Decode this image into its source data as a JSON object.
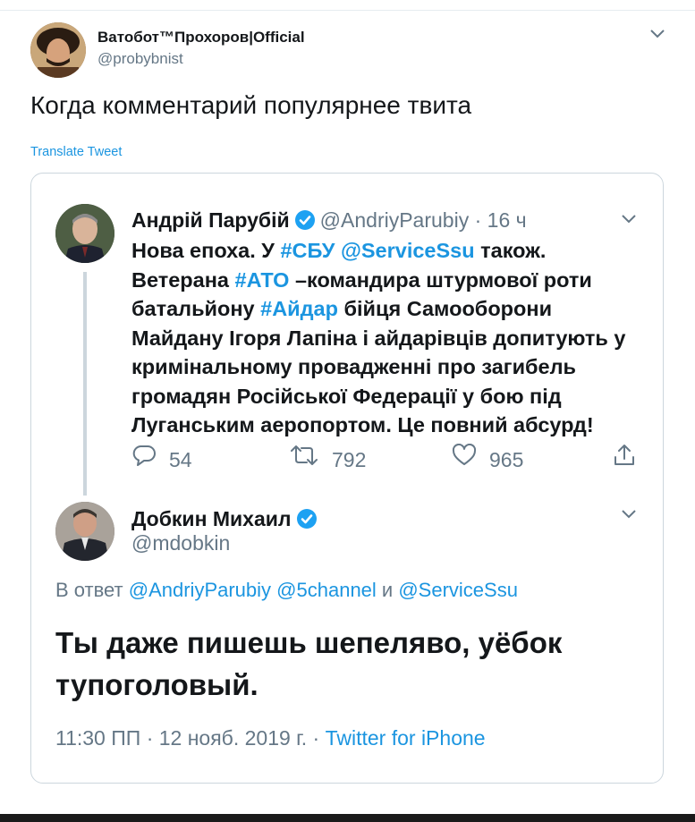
{
  "outer_tweet": {
    "display_name": "Ватобот™Прохоров|Official",
    "handle": "@probybnist",
    "text": "Когда комментарий популярнее твита",
    "translate_label": "Translate Tweet",
    "menu_icon": "chevron-down-icon"
  },
  "quoted_tweet": {
    "display_name": "Андрій Парубій",
    "handle": "@AndriyParubiy",
    "separator": "·",
    "time": "16 ч",
    "verified_icon": "verified-badge-icon",
    "body_lines": [
      [
        {
          "t": "Нова епоха. У ",
          "link": false
        },
        {
          "t": "#СБУ",
          "link": true
        },
        {
          "t": " ",
          "link": false
        },
        {
          "t": "@ServiceSsu",
          "link": true
        },
        {
          "t": " також.",
          "link": false
        }
      ],
      [
        {
          "t": "Ветерана ",
          "link": false
        },
        {
          "t": "#АТО",
          "link": true
        },
        {
          "t": " –командира штурмової роти",
          "link": false
        }
      ],
      [
        {
          "t": "батальйону ",
          "link": false
        },
        {
          "t": "#Айдар",
          "link": true
        },
        {
          "t": "  бійця Самооборони",
          "link": false
        }
      ],
      [
        {
          "t": "Майдану Ігоря Лапіна і айдарівців допитують у",
          "link": false
        }
      ],
      [
        {
          "t": "кримінальному провадженні про загибель",
          "link": false
        }
      ],
      [
        {
          "t": "громадян Російської Федерації у бою під",
          "link": false
        }
      ],
      [
        {
          "t": "Луганським аеропортом. Це повний абсурд!",
          "link": false
        }
      ]
    ],
    "actions": {
      "replies": "54",
      "retweets": "792",
      "likes": "965"
    }
  },
  "reply_tweet": {
    "display_name": "Добкин Михаил",
    "handle": "@mdobkin",
    "reply_prefix": "В ответ ",
    "reply_targets": [
      {
        "t": "@AndriyParubiy",
        "link": true
      },
      {
        "t": " ",
        "link": false
      },
      {
        "t": "@5channel",
        "link": true
      },
      {
        "t": " и ",
        "link": false
      },
      {
        "t": "@ServiceSsu",
        "link": true
      }
    ],
    "body_lines": [
      "Ты даже пишешь шепеляво, уёбок",
      "тупоголовый."
    ],
    "time_date": "11:30 ПП · 12 нояб. 2019 г. · ",
    "source": "Twitter for iPhone"
  },
  "colors": {
    "link": "#1b95e0",
    "muted": "#657786",
    "text": "#14171a",
    "border": "#ccd6dd",
    "verified": "#1da1f2"
  }
}
